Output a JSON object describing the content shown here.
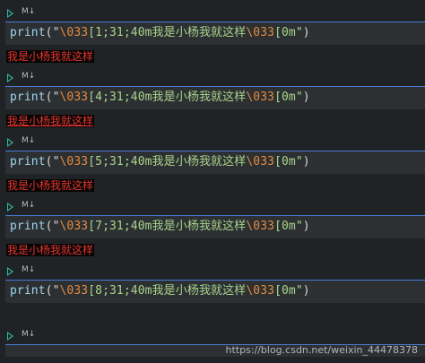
{
  "cells": [
    {
      "tag": "M↓",
      "code": {
        "fn": "print",
        "open": "(\"",
        "esc1": "\\033",
        "mid": "[1;31;40m我是小杨我就这样",
        "esc2": "\\033",
        "end": "[0m\"",
        "close": ")"
      },
      "output": "我是小杨我就这样"
    },
    {
      "tag": "M↓",
      "code": {
        "fn": "print",
        "open": "(\"",
        "esc1": "\\033",
        "mid": "[4;31;40m我是小杨我就这样",
        "esc2": "\\033",
        "end": "[0m\"",
        "close": ")"
      },
      "output": "我是小杨我就这样"
    },
    {
      "tag": "M↓",
      "code": {
        "fn": "print",
        "open": "(\"",
        "esc1": "\\033",
        "mid": "[5;31;40m我是小杨我就这样",
        "esc2": "\\033",
        "end": "[0m\"",
        "close": ")"
      },
      "output": "我是小杨我就这样"
    },
    {
      "tag": "M↓",
      "code": {
        "fn": "print",
        "open": "(\"",
        "esc1": "\\033",
        "mid": "[7;31;40m我是小杨我就这样",
        "esc2": "\\033",
        "end": "[0m\"",
        "close": ")"
      },
      "output": "我是小杨我就这样"
    },
    {
      "tag": "M↓",
      "code": {
        "fn": "print",
        "open": "(\"",
        "esc1": "\\033",
        "mid": "[8;31;40m我是小杨我就这样",
        "esc2": "\\033",
        "end": "[0m\"",
        "close": ")"
      },
      "output": ""
    },
    {
      "tag": "M↓"
    }
  ],
  "watermark": "https://blog.csdn.net/weixin_44478378",
  "colors": {
    "background": "#1f2326",
    "input_bg": "#2c3033",
    "cell_border": "#4b7bd6",
    "run_icon": "#2fb9a4",
    "output_red": "#e8352e",
    "string": "#a9d48a",
    "escape": "#e58a3e",
    "function": "#9fd7ee"
  }
}
